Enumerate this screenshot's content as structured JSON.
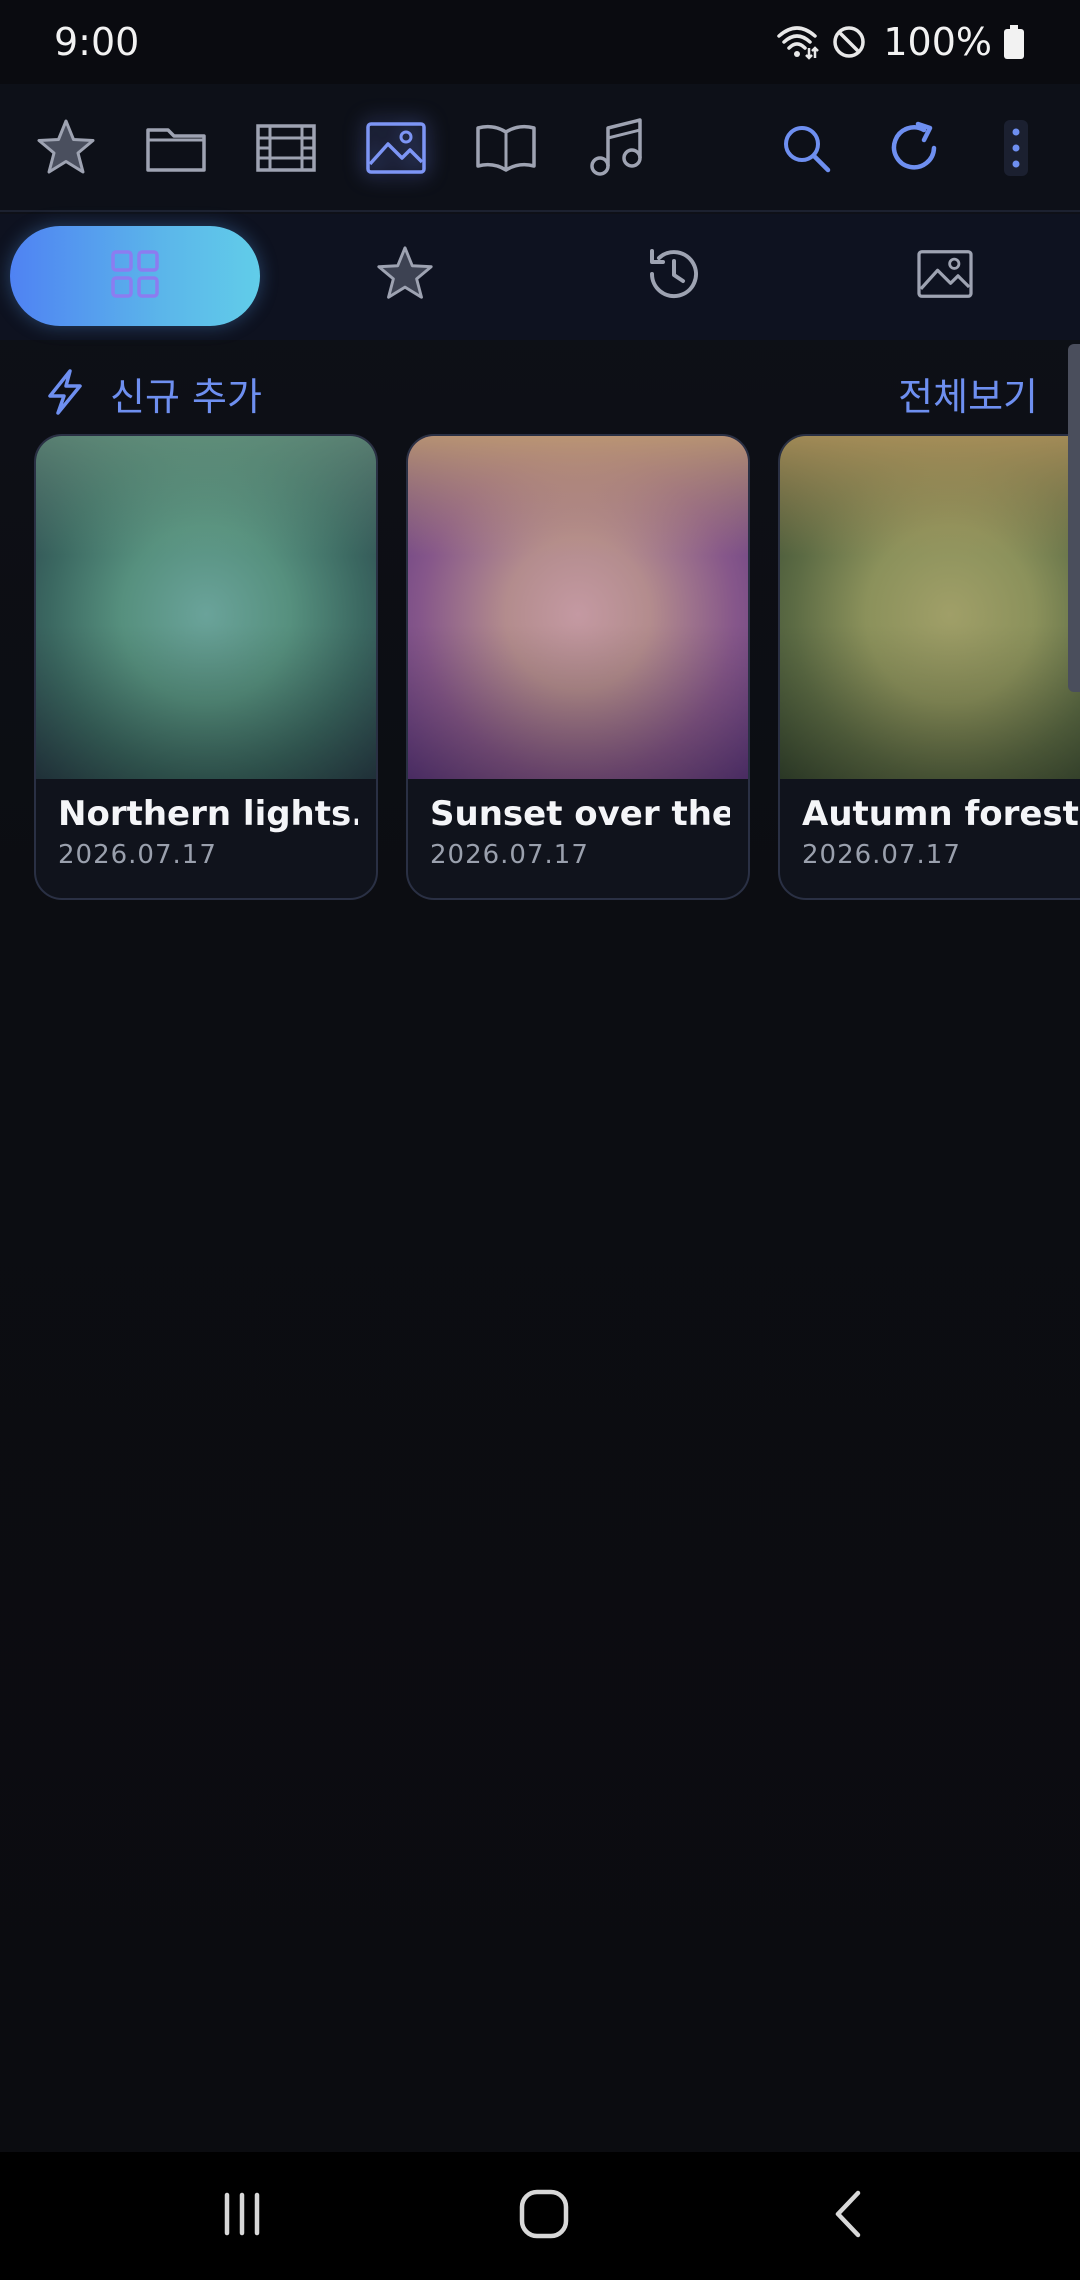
{
  "status_bar": {
    "time": "9:00",
    "battery": "100%"
  },
  "toolbar": {
    "items": [
      {
        "icon": "star-icon",
        "active": false
      },
      {
        "icon": "folder-icon",
        "active": false
      },
      {
        "icon": "film-icon",
        "active": false
      },
      {
        "icon": "image-icon",
        "active": true
      },
      {
        "icon": "book-icon",
        "active": false
      },
      {
        "icon": "music-icon",
        "active": false
      },
      {
        "icon": "search-icon",
        "active": false
      },
      {
        "icon": "refresh-icon",
        "active": false
      },
      {
        "icon": "more-vertical-icon",
        "active": false
      }
    ]
  },
  "tabs": [
    {
      "icon": "grid-icon",
      "active": true
    },
    {
      "icon": "star-icon",
      "active": false
    },
    {
      "icon": "history-icon",
      "active": false
    },
    {
      "icon": "image-icon",
      "active": false
    }
  ],
  "section": {
    "icon": "lightning-icon",
    "title": "신규 추가",
    "view_all": "전체보기"
  },
  "cards": [
    {
      "title": "Northern lights.jpg",
      "date": "2026.07.17"
    },
    {
      "title": "Sunset over the b⋯",
      "date": "2026.07.17"
    },
    {
      "title": "Autumn forest tr⋯",
      "date": "2026.07.17"
    }
  ],
  "colors": {
    "accent": "#6e8ff0",
    "tab_gradient_start": "#4f82f3",
    "tab_gradient_end": "#61cde9",
    "background": "#0c0d12"
  },
  "navbar": {
    "items": [
      "recents-icon",
      "home-icon",
      "back-icon"
    ]
  }
}
